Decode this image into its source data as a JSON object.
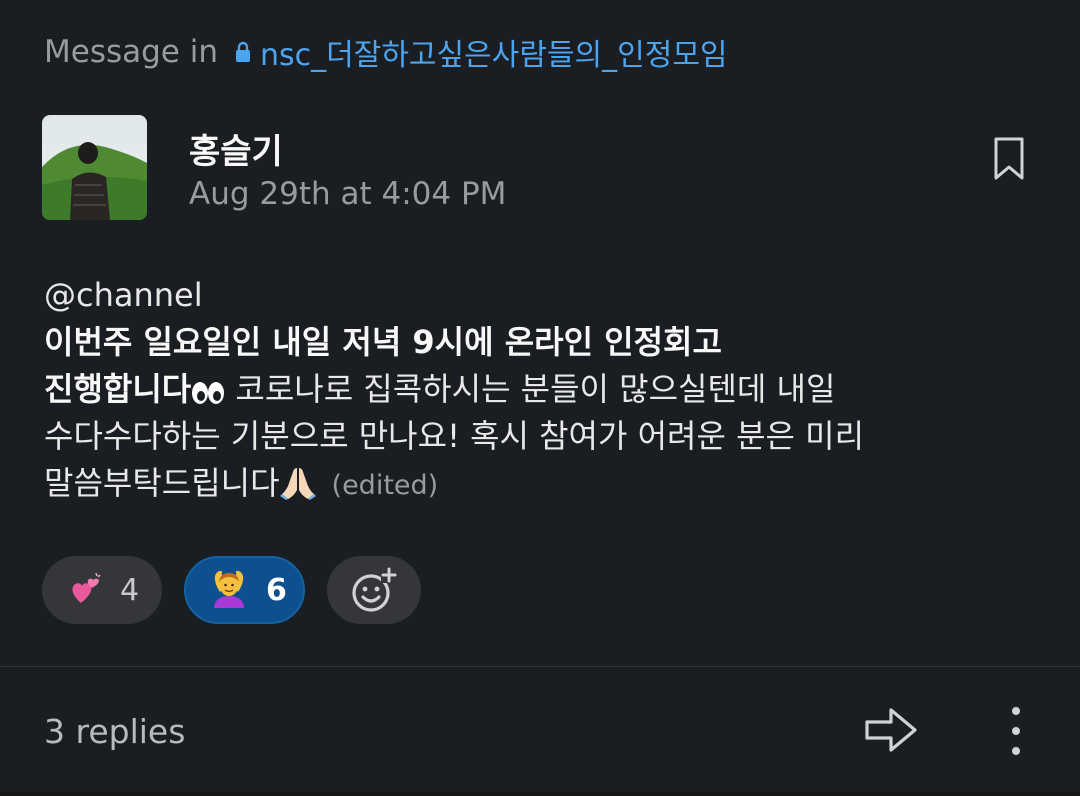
{
  "header": {
    "prefix": "Message in",
    "channel_icon": "lock-icon",
    "channel_name": "nsc_더잘하고싶은사람들의_인정모임"
  },
  "message": {
    "author": "홍슬기",
    "timestamp": "Aug 29th at 4:04 PM",
    "mention": "@channel",
    "line1": "이번주 일요일인 내일 저녁 9시에 온라인 인정회고",
    "line2_bold": "진행합니다",
    "line2_rest": " 코로나로 집콕하시는 분들이 많으실텐데 내일",
    "line3": "수다수다하는 기분으로 만나요! 혹시 참여가 어려운 분은 미리",
    "line4": "말씀부탁드립니다",
    "edited": "(edited)",
    "inline_emojis": [
      "eyes",
      "folded-hands"
    ]
  },
  "reactions": [
    {
      "emoji": "heart-emoji",
      "count": "4",
      "selected": false
    },
    {
      "emoji": "person-gesturing-ok-emoji",
      "count": "6",
      "selected": true
    },
    {
      "emoji": "add-reaction-icon"
    }
  ],
  "footer": {
    "replies": "3 replies",
    "share_icon": "share-arrow-icon",
    "more_icon": "more-vertical-icon"
  },
  "colors": {
    "background": "#1a1d21",
    "link": "#4da4ee",
    "selected_reaction": "#0e4f8f",
    "reaction_bg": "#34363a"
  }
}
